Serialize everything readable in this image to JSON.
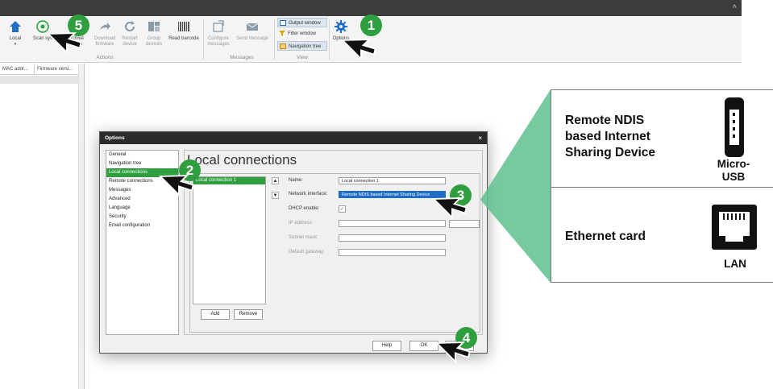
{
  "ribbon": {
    "local": "Local",
    "scan_system": "Scan sys",
    "archive_scan_top": "rchive",
    "archive_scan_bottom": "scan",
    "download_firmware": "Download firmware",
    "restart_device": "Restart device",
    "group_devices": "Group devices",
    "read_barcode": "Read barcode",
    "configure_messages": "Configure messages",
    "send_message": "Send message",
    "output_window": "Output window",
    "filter_window": "Filter window",
    "navigation_tree": "Navigation tree",
    "options": "Options",
    "group_actions": "Actions",
    "group_messages": "Messages",
    "group_view": "View"
  },
  "left_panel": {
    "col1": "MAC addr...",
    "col2": "Firmware versi..."
  },
  "dialog": {
    "title": "Options",
    "close": "×",
    "nav": [
      "General",
      "Navigation tree",
      "Local connections",
      "Remote connections",
      "Messages",
      "Advanced",
      "Language",
      "Security",
      "Email configuration"
    ],
    "heading": "Local connections",
    "connection_item": "Local connection 1",
    "add": "Add",
    "remove": "Remove",
    "labels": {
      "name": "Name:",
      "network_interface": "Network interface:",
      "dhcp": "DHCP enable:",
      "ip": "IP address:",
      "subnet": "Subnet mask:",
      "gateway": "Default gateway:"
    },
    "name_value": "Local connection 1",
    "network_value": "Remote NDIS based Internet Sharing Device",
    "dhcp_check": "✓",
    "help": "Help",
    "ok": "OK"
  },
  "badges": [
    "1",
    "2",
    "3",
    "4",
    "5"
  ],
  "callout": {
    "ndis_line1": "Remote NDIS",
    "ndis_line2": "based Internet",
    "ndis_line3": "Sharing Device",
    "micro_usb_1": "Micro-",
    "micro_usb_2": "USB",
    "ethernet": "Ethernet card",
    "lan": "LAN"
  },
  "colors": {
    "accent": "#2e9e3e",
    "selection": "#1f6cc4",
    "callout_green": "#5fbf8f"
  }
}
